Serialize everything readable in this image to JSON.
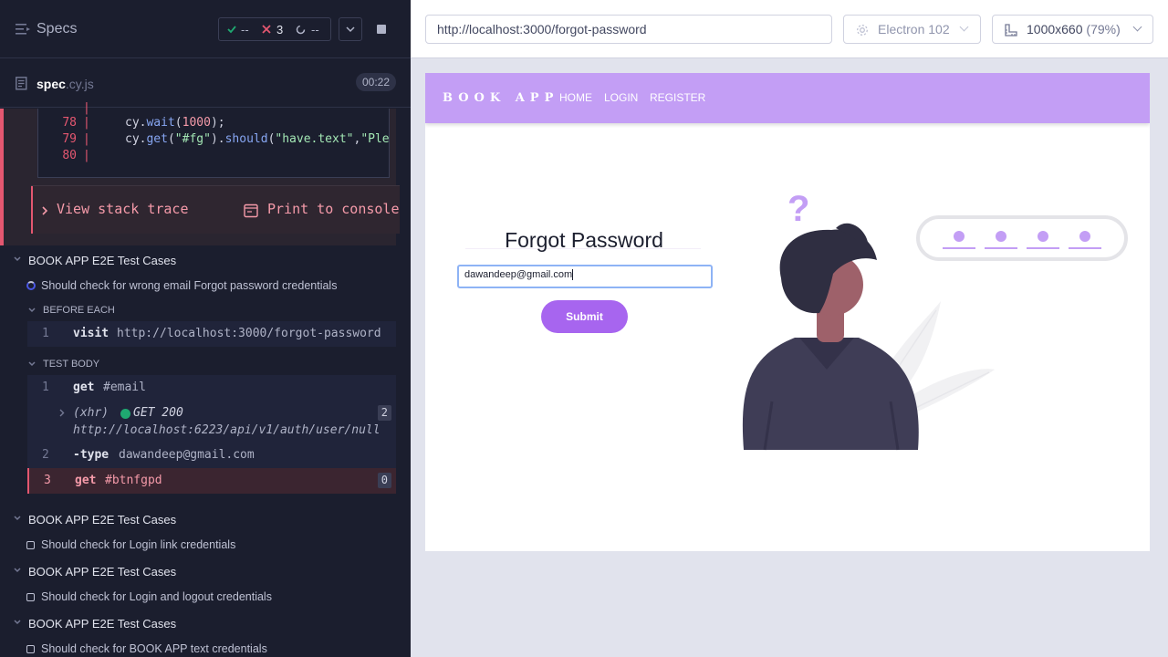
{
  "reporter": {
    "header": {
      "title": "Specs",
      "passed": "--",
      "failed": "3",
      "pending": "--"
    },
    "file": {
      "name": "spec",
      "ext": ".cy.js",
      "duration": "00:22"
    },
    "error": {
      "code_lines": [
        {
          "num": "78",
          "parts": [
            "cy.",
            "wait",
            "(",
            "1000",
            ");"
          ]
        },
        {
          "num": "79",
          "parts": [
            "cy.",
            "get",
            "(",
            "\"#fg\"",
            ").",
            "should",
            "(",
            "\"have.text\"",
            ",",
            "\"Ple"
          ]
        },
        {
          "num": "80",
          "parts": []
        }
      ],
      "view_stack": "View stack trace",
      "print_console": "Print to console"
    },
    "suites": [
      {
        "title": "BOOK APP E2E Test Cases",
        "test": "Should check for wrong email Forgot password credentials"
      },
      {
        "title": "BOOK APP E2E Test Cases",
        "test": "Should check for Login link credentials"
      },
      {
        "title": "BOOK APP E2E Test Cases",
        "test": "Should check for Login and logout credentials"
      },
      {
        "title": "BOOK APP E2E Test Cases",
        "test": "Should check for BOOK APP text credentials"
      }
    ],
    "before_each": {
      "label": "BEFORE EACH",
      "commands": [
        {
          "num": "1",
          "name": "visit",
          "msg": "http://localhost:3000/forgot-password"
        }
      ]
    },
    "test_body": {
      "label": "TEST BODY",
      "commands": [
        {
          "num": "1",
          "name": "get",
          "msg": "#email"
        },
        {
          "xhr": "(xhr)",
          "method": "GET 200",
          "url": "http://localhost:6223/api/v1/auth/user/null",
          "count": "2"
        },
        {
          "num": "2",
          "name": "-type",
          "msg": "dawandeep@gmail.com"
        },
        {
          "num": "3",
          "name": "get",
          "msg": "#btnfgpd",
          "count": "0"
        }
      ]
    }
  },
  "aut": {
    "url": "http://localhost:3000/forgot-password",
    "browser": "Electron 102",
    "viewport": "1000x660",
    "zoom": "(79%)",
    "app": {
      "brand": "BOOK APP",
      "nav": [
        "HOME",
        "LOGIN",
        "REGISTER"
      ],
      "heading": "Forgot Password",
      "email_value": "dawandeep@gmail.com",
      "submit_label": "Submit",
      "illustration_mark": "?"
    }
  },
  "colors": {
    "accent_purple": "#a765ef",
    "navbar": "#c39ef5",
    "fail_red": "#e45770",
    "pass_green": "#1fa971",
    "reporter_bg": "#1b1e2e"
  },
  "icons": [
    "menu-icon",
    "check-icon",
    "x-icon",
    "spinner-icon",
    "chevron-down-icon",
    "stop-icon",
    "document-icon",
    "chevron-right-icon",
    "console-icon",
    "gear-icon",
    "ruler-icon"
  ]
}
